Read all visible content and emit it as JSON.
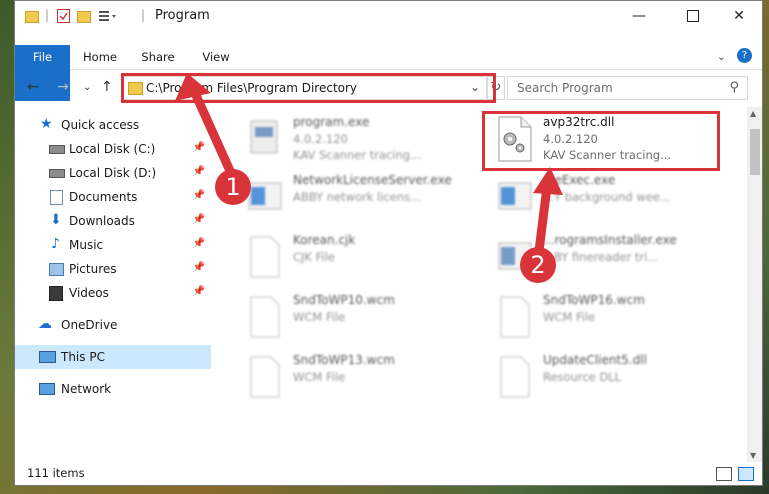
{
  "window": {
    "title": "Program",
    "minimize_icon": "minimize-icon",
    "maximize_icon": "maximize-icon",
    "close_icon": "close-icon"
  },
  "ribbon": {
    "tabs": [
      "File",
      "Home",
      "Share",
      "View"
    ],
    "help_icon": "help-icon"
  },
  "address": {
    "path": "C:\\Program Files\\Program Directory",
    "search_placeholder": "Search Program"
  },
  "sidebar": {
    "items": [
      {
        "label": "Quick access",
        "icon": "star-icon"
      },
      {
        "label": "Local Disk (C:)",
        "icon": "drive-icon",
        "pinned": true
      },
      {
        "label": "Local Disk (D:)",
        "icon": "drive-icon",
        "pinned": true
      },
      {
        "label": "Documents",
        "icon": "documents-icon",
        "pinned": true
      },
      {
        "label": "Downloads",
        "icon": "downloads-icon",
        "pinned": true
      },
      {
        "label": "Music",
        "icon": "music-icon",
        "pinned": true
      },
      {
        "label": "Pictures",
        "icon": "pictures-icon",
        "pinned": true
      },
      {
        "label": "Videos",
        "icon": "videos-icon",
        "pinned": true
      },
      {
        "label": "OneDrive",
        "icon": "cloud-icon"
      },
      {
        "label": "This PC",
        "icon": "computer-icon",
        "selected": true
      },
      {
        "label": "Network",
        "icon": "network-icon"
      }
    ]
  },
  "files": [
    {
      "name": "program.exe",
      "line2": "4.0.2.120",
      "line3": "KAV Scanner tracing...",
      "blurred": true
    },
    {
      "name": "avp32trc.dll",
      "line2": "4.0.2.120",
      "line3": "KAV Scanner tracing...",
      "blurred": false
    },
    {
      "name": "NetworkLicenseServer.exe",
      "line2": "ABBY network licens...",
      "line3": "",
      "blurred": true
    },
    {
      "name": "...eExec.exe",
      "line2": "...Y background wee...",
      "line3": "",
      "blurred": true
    },
    {
      "name": "Korean.cjk",
      "line2": "CJK File",
      "line3": "",
      "blurred": true
    },
    {
      "name": "...rogramsInstaller.exe",
      "line2": "...BY finereader tri...",
      "line3": "",
      "blurred": true
    },
    {
      "name": "SndToWP10.wcm",
      "line2": "WCM File",
      "line3": "",
      "blurred": true
    },
    {
      "name": "SndToWP16.wcm",
      "line2": "WCM File",
      "line3": "",
      "blurred": true
    },
    {
      "name": "SndToWP13.wcm",
      "line2": "WCM File",
      "line3": "",
      "blurred": true
    },
    {
      "name": "UpdateClient5.dll",
      "line2": "Resource DLL",
      "line3": "",
      "blurred": true
    }
  ],
  "status": {
    "count": "111 items"
  },
  "annotations": {
    "step1": "1",
    "step2": "2"
  },
  "colors": {
    "accent": "#1a6fc9",
    "highlight": "#d9343a",
    "selection": "#cce8ff"
  }
}
